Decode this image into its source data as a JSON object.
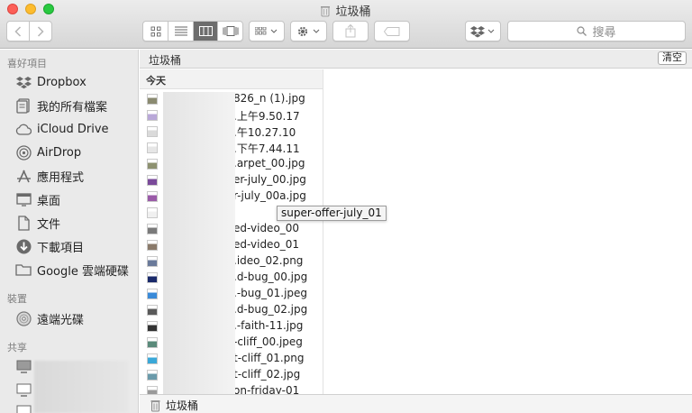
{
  "window": {
    "title": "垃圾桶"
  },
  "toolbar": {
    "back_icon": "chevron-left-icon",
    "forward_icon": "chevron-right-icon",
    "view_modes": [
      "icon-view-icon",
      "list-view-icon",
      "column-view-icon",
      "cover-flow-icon"
    ],
    "active_view_index": 2,
    "search_placeholder": "搜尋"
  },
  "sidebar": {
    "favorites_header": "喜好項目",
    "favorites": [
      {
        "label": "Dropbox",
        "icon": "dropbox-icon"
      },
      {
        "label": "我的所有檔案",
        "icon": "all-files-icon"
      },
      {
        "label": "iCloud Drive",
        "icon": "cloud-icon"
      },
      {
        "label": "AirDrop",
        "icon": "airdrop-icon"
      },
      {
        "label": "應用程式",
        "icon": "applications-icon"
      },
      {
        "label": "桌面",
        "icon": "desktop-icon"
      },
      {
        "label": "文件",
        "icon": "documents-icon"
      },
      {
        "label": "下載項目",
        "icon": "downloads-icon"
      },
      {
        "label": "Google 雲端硬碟",
        "icon": "folder-icon"
      }
    ],
    "devices_header": "裝置",
    "devices": [
      {
        "label": "遠端光碟",
        "icon": "remote-disc-icon"
      }
    ],
    "shared_header": "共享"
  },
  "pathbar": {
    "current": "垃圾桶",
    "empty_button": "清空"
  },
  "column": {
    "group_header": "今天",
    "files": [
      {
        "name": "826_n (1).jpg",
        "thumb": "#8a8a70"
      },
      {
        "name": ".上午9.50.17",
        "thumb": "#b9a8d8"
      },
      {
        "name": ".午10.27.10",
        "thumb": "#dadada"
      },
      {
        "name": ".下午7.44.11",
        "thumb": "#e6e6e6"
      },
      {
        "name": ".arpet_00.jpg",
        "thumb": "#8d9170"
      },
      {
        "name": "er-july_00.jpg",
        "thumb": "#7a4a9a"
      },
      {
        "name": "r-july_00a.jpg",
        "thumb": "#9a5aa8"
      },
      {
        "name": "",
        "thumb": "#f0f0f0"
      },
      {
        "name": "ed-video_00",
        "thumb": "#7a7a7a"
      },
      {
        "name": "ed-video_01",
        "thumb": "#8a7a6a"
      },
      {
        "name": ".ideo_02.png",
        "thumb": "#6a7a9a"
      },
      {
        "name": ".d-bug_00.jpg",
        "thumb": "#1a2a6a"
      },
      {
        "name": ".-bug_01.jpeg",
        "thumb": "#3a8ad8"
      },
      {
        "name": ".d-bug_02.jpg",
        "thumb": "#5a5a5a"
      },
      {
        "name": ".-faith-11.jpg",
        "thumb": "#333333"
      },
      {
        "name": "-cliff_00.jpeg",
        "thumb": "#5a8a7a"
      },
      {
        "name": "t-cliff_01.png",
        "thumb": "#3aa8d8"
      },
      {
        "name": "t-cliff_02.jpg",
        "thumb": "#6a9aaa"
      },
      {
        "name": "on-friday-01",
        "thumb": "#9a9a9a"
      }
    ],
    "tooltip": "super-offer-july_01"
  },
  "statusbar": {
    "path": "垃圾桶"
  }
}
